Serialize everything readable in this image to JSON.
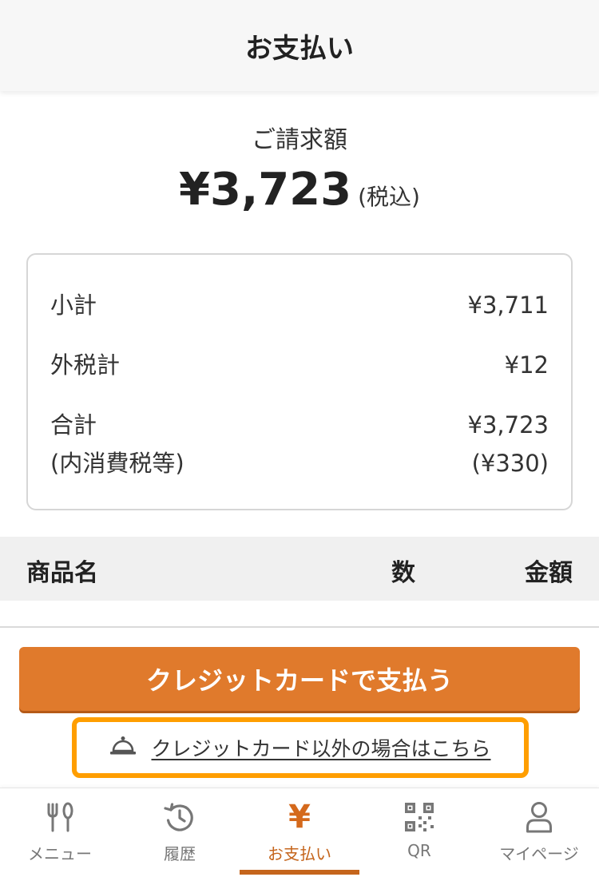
{
  "header": {
    "title": "お支払い"
  },
  "billing": {
    "label": "ご請求額",
    "amount": "¥3,723",
    "tax_note": "(税込)"
  },
  "summary": {
    "subtotal_label": "小計",
    "subtotal_value": "¥3,711",
    "external_tax_label": "外税計",
    "external_tax_value": "¥12",
    "total_label": "合計",
    "total_value": "¥3,723",
    "internal_tax_label": "(内消費税等)",
    "internal_tax_value": "(¥330)"
  },
  "items_table": {
    "headers": {
      "name": "商品名",
      "quantity": "数",
      "amount": "金額"
    }
  },
  "actions": {
    "pay_button_label": "クレジットカードで支払う",
    "alt_pay_label": "クレジットカード以外の場合はこちら"
  },
  "tabs": [
    {
      "label": "メニュー",
      "icon": "fork-knife-icon"
    },
    {
      "label": "履歴",
      "icon": "history-icon"
    },
    {
      "label": "お支払い",
      "icon": "yen-icon",
      "active": true
    },
    {
      "label": "QR",
      "icon": "qr-code-icon"
    },
    {
      "label": "マイページ",
      "icon": "person-icon"
    }
  ],
  "colors": {
    "accent": "#e07a2c",
    "accent_dark": "#c5651c",
    "highlight_border": "#ff9e00"
  }
}
